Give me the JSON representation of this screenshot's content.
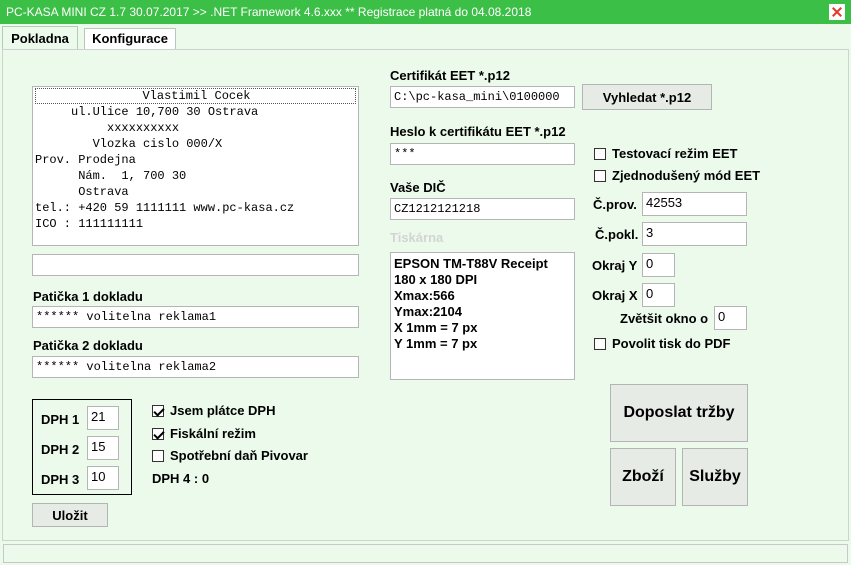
{
  "window": {
    "title": "PC-KASA MINI CZ 1.7 30.07.2017 >> .NET Framework 4.6.xxx ** Registrace platná do 04.08.2018"
  },
  "tabs": [
    {
      "label": "Pokladna",
      "active": true
    },
    {
      "label": "Konfigurace",
      "active": false
    }
  ],
  "receipt_header": {
    "lines": [
      "Vlastimil Cocek",
      "     ul.Ulice 10,700 30 Ostrava",
      "          xxxxxxxxxx",
      "        Vlozka cislo 000/X",
      "Prov. Prodejna",
      "      Nám.  1, 700 30",
      "      Ostrava",
      "tel.: +420 59 1111111 www.pc-kasa.cz",
      "ICO : 111111111"
    ],
    "extra_line_value": ""
  },
  "footer": {
    "footer1_label": "Patička 1 dokladu",
    "footer1_value": "******  volitelna reklama1",
    "footer2_label": "Patička 2 dokladu",
    "footer2_value": "******  volitelna reklama2"
  },
  "dph": {
    "dph1_label": "DPH 1",
    "dph1_value": "21",
    "dph2_label": "DPH 2",
    "dph2_value": "15",
    "dph3_label": "DPH 3",
    "dph3_value": "10",
    "dph4_text": "DPH 4 : 0"
  },
  "checks_left": {
    "vat_payer_label": "Jsem plátce DPH",
    "vat_payer_checked": true,
    "fiscal_mode_label": "Fiskální režim",
    "fiscal_mode_checked": true,
    "excise_label": "Spotřební daň Pivovar",
    "excise_checked": false
  },
  "save_button": "Uložit",
  "eet": {
    "cert_label": "Certifikát EET *.p12",
    "cert_value": "C:\\pc-kasa_mini\\0100000",
    "browse_button": "Vyhledat *.p12",
    "password_label": "Heslo k certifikátu EET *.p12",
    "password_value": "***",
    "dic_label": "Vaše DIČ",
    "dic_value": "CZ1212121218"
  },
  "printer": {
    "label": "Tiskárna",
    "lines": [
      "EPSON TM-T88V Receipt",
      "180 x 180 DPI",
      "Xmax:566",
      "Ymax:2104",
      "X 1mm = 7 px",
      "Y 1mm = 7 px"
    ]
  },
  "options": {
    "test_mode_label": "Testovací režim EET",
    "test_mode_checked": false,
    "simplified_label": "Zjednodušený mód EET",
    "simplified_checked": false,
    "prov_label": "Č.prov.",
    "prov_value": "42553",
    "pokl_label": "Č.pokl.",
    "pokl_value": "3",
    "margin_y_label": "Okraj Y",
    "margin_y_value": "0",
    "margin_x_label": "Okraj X",
    "margin_x_value": "0",
    "zoom_label": "Zvětšit okno o",
    "zoom_value": "0",
    "pdf_label": "Povolit tisk do PDF",
    "pdf_checked": false
  },
  "actions": {
    "send_sales": "Doposlat tržby",
    "goods": "Zboží",
    "services": "Služby"
  },
  "colors": {
    "titlebar": "#3cbf46",
    "background": "#ebfaeb",
    "close_icon": "#e43a2e"
  }
}
